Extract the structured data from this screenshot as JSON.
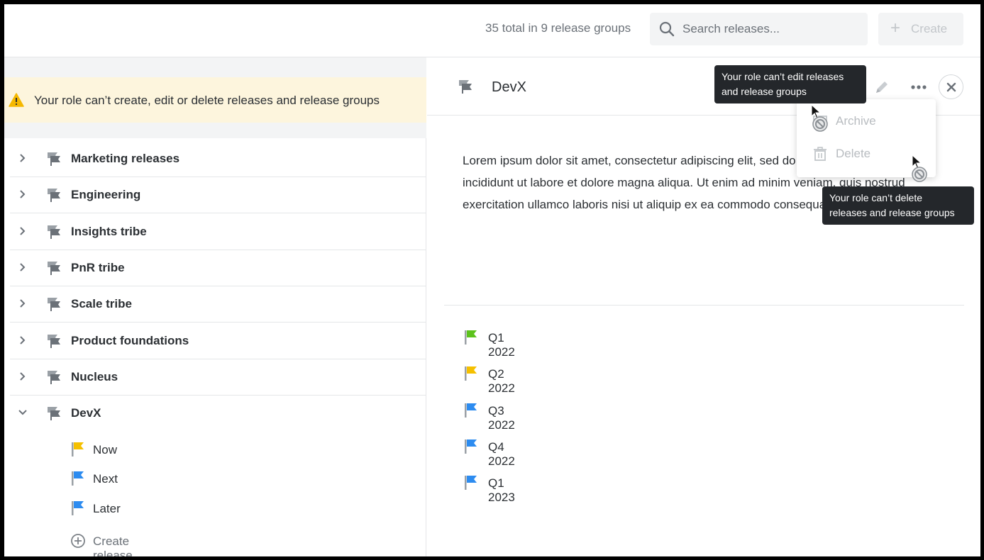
{
  "header": {
    "total_count": "35 total in 9 release groups",
    "search_placeholder": "Search releases...",
    "create_label": "Create"
  },
  "warning": {
    "text": "Your role can’t create, edit or delete releases and release groups"
  },
  "groups": [
    {
      "name": "Marketing releases",
      "expanded": false
    },
    {
      "name": "Engineering",
      "expanded": false
    },
    {
      "name": "Insights tribe",
      "expanded": false
    },
    {
      "name": "PnR tribe",
      "expanded": false
    },
    {
      "name": "Scale tribe",
      "expanded": false
    },
    {
      "name": "Product foundations",
      "expanded": false
    },
    {
      "name": "Nucleus",
      "expanded": false
    },
    {
      "name": "DevX",
      "expanded": true
    }
  ],
  "devx_releases": [
    {
      "name": "Now",
      "color": "#f5c000"
    },
    {
      "name": "Next",
      "color": "#2d8cf0"
    },
    {
      "name": "Later",
      "color": "#2d8cf0"
    }
  ],
  "create_release_label": "Create release",
  "detail": {
    "title": "DevX",
    "description": "Lorem ipsum dolor sit amet, consectetur adipiscing elit, sed do eiusmod tempor incididunt ut labore et dolore magna aliqua. Ut enim ad minim veniam, quis nostrud exercitation ullamco laboris nisi ut aliquip ex ea commodo consequat.",
    "releases": [
      {
        "name": "Q1 2022",
        "color": "#5cc21c"
      },
      {
        "name": "Q2 2022",
        "color": "#f5c000"
      },
      {
        "name": "Q3 2022",
        "color": "#2d8cf0"
      },
      {
        "name": "Q4 2022",
        "color": "#2d8cf0"
      },
      {
        "name": "Q1 2023",
        "color": "#2d8cf0"
      }
    ]
  },
  "menu": {
    "archive_label": "Archive",
    "delete_label": "Delete"
  },
  "tooltips": {
    "edit_line1": "Your role can’t edit releases",
    "edit_line2": "and release groups",
    "delete_line1": "Your role can’t delete",
    "delete_line2": "releases and release groups"
  },
  "colors": {
    "warning_bg": "#fdf5dd",
    "warning_icon": "#f5b800",
    "tooltip_bg": "#24272b"
  }
}
